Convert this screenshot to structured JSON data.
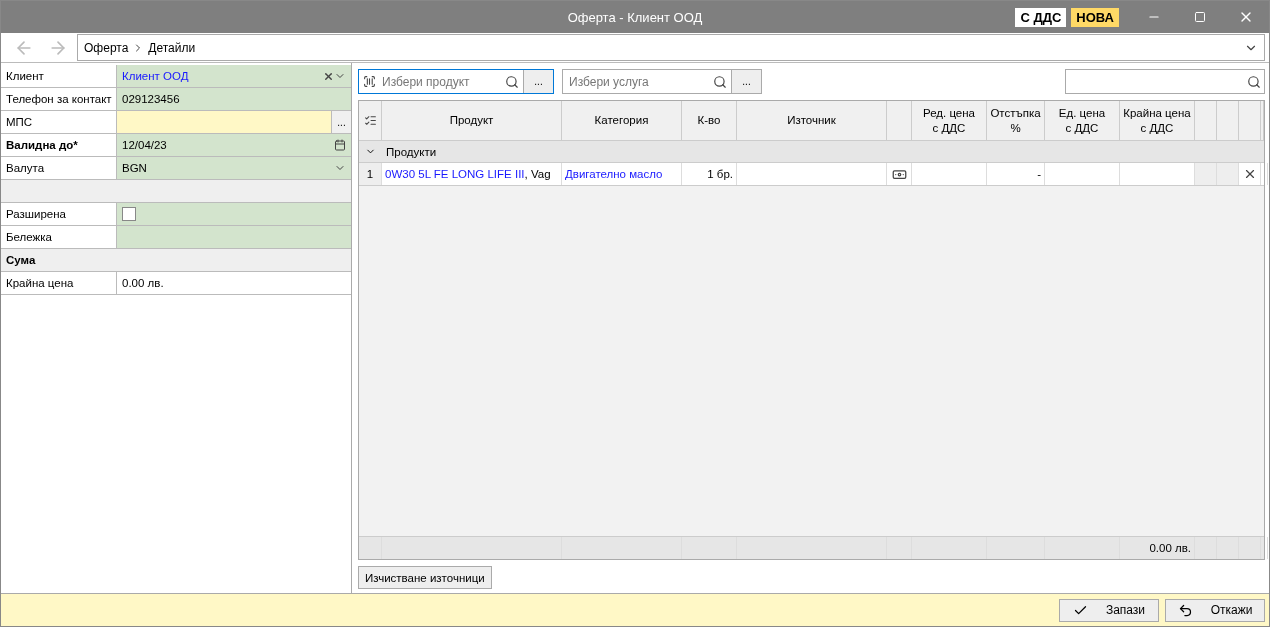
{
  "window": {
    "title": "Оферта - Клиент ООД",
    "badges": [
      {
        "label": "С ДДС",
        "color": "#ffffff"
      },
      {
        "label": "НОВА",
        "color": "#ffd966"
      }
    ]
  },
  "breadcrumb": [
    "Оферта",
    "Детайли"
  ],
  "form": [
    {
      "kind": "combo",
      "label": "Клиент",
      "value": "Клиент ООД"
    },
    {
      "kind": "text",
      "label": "Телефон за контакт",
      "value": "029123456"
    },
    {
      "kind": "lookup",
      "label": "МПС",
      "button": "..."
    },
    {
      "kind": "date",
      "label": "Валидна до*",
      "value": "12/04/23",
      "required": true
    },
    {
      "kind": "select",
      "label": "Валута",
      "value": "BGN"
    },
    {
      "kind": "blank"
    },
    {
      "kind": "checkbox",
      "label": "Разширена",
      "checked": false
    },
    {
      "kind": "text",
      "label": "Бележка"
    },
    {
      "kind": "section",
      "label": "Сума"
    },
    {
      "kind": "plain",
      "label": "Крайна цена",
      "value": "0.00 лв."
    }
  ],
  "product_search": {
    "placeholder": "Избери продукт",
    "button": "..."
  },
  "service_search": {
    "placeholder": "Избери услуга",
    "button": "..."
  },
  "columns": [
    {
      "kind": "menu"
    },
    {
      "label": "Продукт"
    },
    {
      "label": "Категория"
    },
    {
      "label": "К-во"
    },
    {
      "label": "Източник"
    },
    {
      "kind": "blank"
    },
    {
      "label": "Ред. цена\nс ДДС"
    },
    {
      "label": "Отстъпка\n%"
    },
    {
      "label": "Ед. цена\nс ДДС"
    },
    {
      "label": "Крайна цена\nс ДДС"
    },
    {
      "kind": "blank"
    },
    {
      "kind": "blank"
    },
    {
      "kind": "blank"
    }
  ],
  "group": {
    "label": "Продукти",
    "expanded": true
  },
  "rows": [
    {
      "number": "1",
      "product": "0W30 5L FE LONG LIFE III",
      "product_suffix": ", Vag",
      "category": "Двигателно масло",
      "quantity": "1 бр.",
      "discount": "-"
    }
  ],
  "total": "0.00 лв.",
  "clear_button": "Изчистване източници",
  "buttons": [
    {
      "kind": "save",
      "label": "Запази"
    },
    {
      "kind": "cancel",
      "label": "Откажи"
    }
  ]
}
